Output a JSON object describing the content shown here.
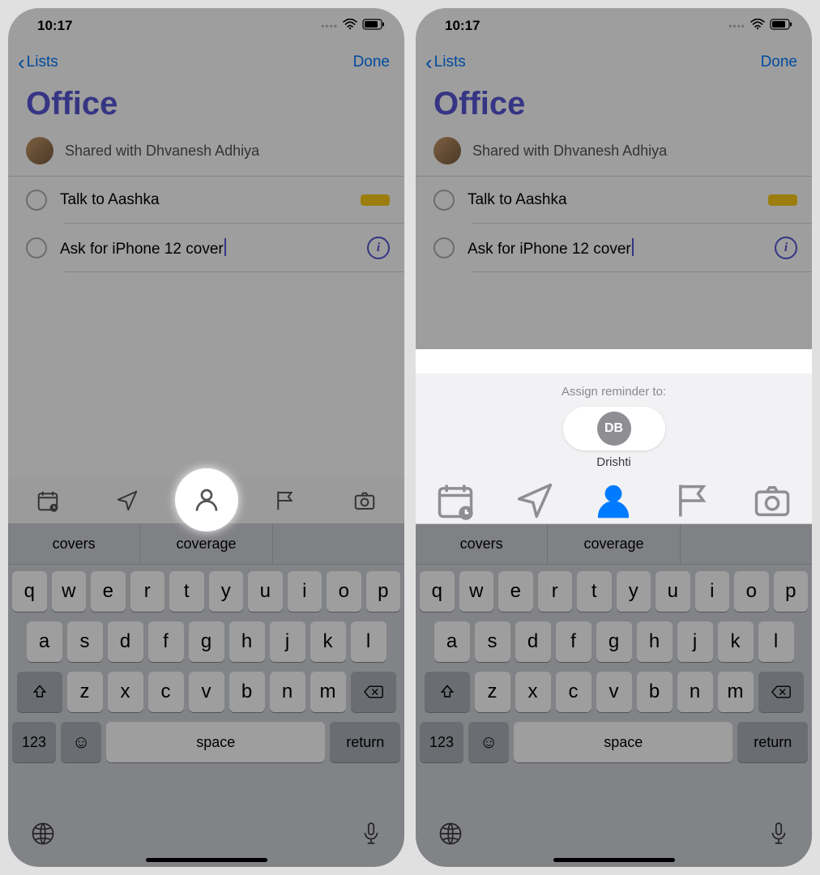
{
  "status": {
    "time": "10:17"
  },
  "nav": {
    "back": "Lists",
    "done": "Done"
  },
  "list": {
    "title": "Office",
    "shared_with_label": "Shared with Dhvanesh Adhiya"
  },
  "reminders": [
    {
      "text": "Talk to Aashka",
      "flagged": true
    },
    {
      "text": "Ask for iPhone 12 cover",
      "editing": true
    }
  ],
  "assign": {
    "title": "Assign reminder to:",
    "option_initials": "DB",
    "option_name": "Drishti"
  },
  "keyboard": {
    "predictions": [
      "covers",
      "coverage"
    ],
    "row1": [
      "q",
      "w",
      "e",
      "r",
      "t",
      "y",
      "u",
      "i",
      "o",
      "p"
    ],
    "row2": [
      "a",
      "s",
      "d",
      "f",
      "g",
      "h",
      "j",
      "k",
      "l"
    ],
    "row3": [
      "z",
      "x",
      "c",
      "v",
      "b",
      "n",
      "m"
    ],
    "num_label": "123",
    "space_label": "space",
    "return_label": "return"
  }
}
